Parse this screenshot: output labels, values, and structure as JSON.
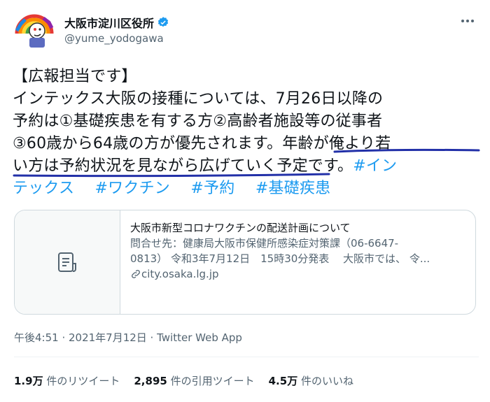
{
  "account": {
    "display_name": "大阪市淀川区役所",
    "handle": "@yume_yodogawa",
    "avatar_icon": "rainbow-mascot-avatar",
    "verified_icon": "verified-badge-icon"
  },
  "tweet": {
    "lines": [
      {
        "text": "【広報担当です】"
      },
      {
        "text": "インテックス大阪の接種については、7月26日以降の"
      },
      {
        "text": "予約は①基礎疾患を有する方②高齢者施設等の従事者"
      },
      {
        "pre": "③60歳から64歳の方が優先されます。",
        "marked": "年齢が俺より若"
      },
      {
        "marked": "い方は予約状況を見ながら広げていく",
        "post": "予定です。",
        "tag": "#イン"
      },
      {
        "tag_cont": "テックス",
        "tags": [
          "#ワクチン",
          "#予約",
          "#基礎疾患"
        ]
      }
    ]
  },
  "card": {
    "title": "大阪市新型コロナワクチンの配送計画について",
    "desc_line1": "問合せ先：健康局大阪市保健所感染症対策課（06-6647-",
    "desc_line2": "0813） 令和3年7月12日　15時30分発表　 大阪市では、 令...",
    "domain": "city.osaka.lg.jp",
    "thumb_icon": "document-icon",
    "link_icon": "link-icon"
  },
  "meta": {
    "timestamp": "午後4:51 · 2021年7月12日 · Twitter Web App"
  },
  "stats": {
    "retweets_count": "1.9万",
    "retweets_label": "件のリツイート",
    "quotes_count": "2,895",
    "quotes_label": "件の引用ツイート",
    "likes_count": "4.5万",
    "likes_label": "件のいいね"
  },
  "colors": {
    "link": "#1d9bf0",
    "secondary": "#536471",
    "underline": "#2230a8"
  }
}
